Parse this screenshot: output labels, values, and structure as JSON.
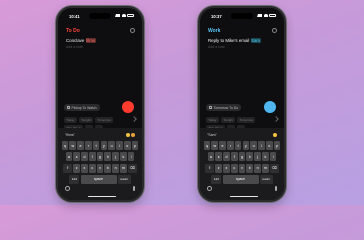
{
  "phones": [
    {
      "status_time": "10:41",
      "list_title": "To Do",
      "list_color": "#ff453a",
      "task_text": "Conclave ",
      "task_highlight": "films",
      "highlight_bg": "#5a2d2b",
      "highlight_color": "#ff6b5e",
      "notes_placeholder": "Add a note",
      "chip_label": "Pickup To Watch",
      "chip_labels": [
        "Today",
        "Tonight",
        "Tomorrow",
        "This Week"
      ],
      "fab_color": "#ff3b30",
      "suggestion": "\"films\""
    },
    {
      "status_time": "10:37",
      "list_title": "Work",
      "list_color": "#5ac8fa",
      "task_text": "Reply to Mike's email ",
      "task_highlight": "Sam",
      "highlight_bg": "#17444d",
      "highlight_color": "#5ac8fa",
      "notes_placeholder": "Add a note",
      "chip_label": "Tomorrow To Do",
      "chip_labels": [
        "Today",
        "Tonight",
        "Tomorrow",
        "This Week"
      ],
      "fab_color": "#4fb6f0",
      "suggestion": "\"Sam\""
    }
  ],
  "keyboard": {
    "row1": [
      "q",
      "w",
      "e",
      "r",
      "t",
      "y",
      "u",
      "i",
      "o",
      "p"
    ],
    "row2": [
      "a",
      "s",
      "d",
      "f",
      "g",
      "h",
      "j",
      "k",
      "l"
    ],
    "row3": [
      "z",
      "x",
      "c",
      "v",
      "b",
      "n",
      "m"
    ],
    "numbers_key": "123",
    "space_label": "space",
    "return_label": "return"
  }
}
